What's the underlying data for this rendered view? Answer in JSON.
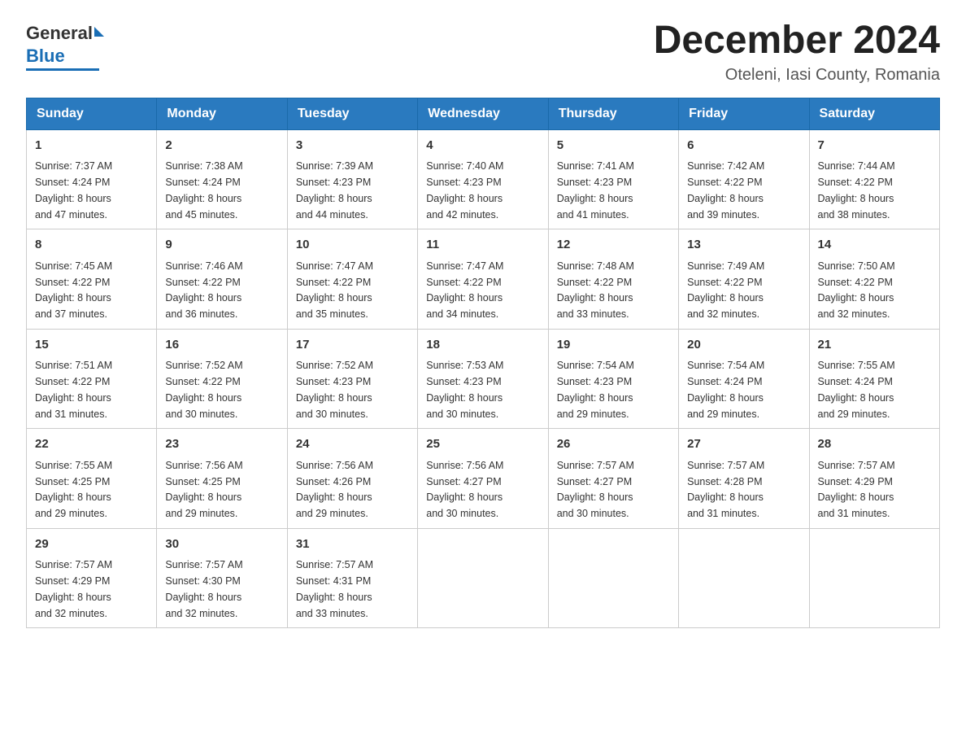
{
  "header": {
    "logo_general": "General",
    "logo_blue": "Blue",
    "month_title": "December 2024",
    "location": "Oteleni, Iasi County, Romania"
  },
  "days_of_week": [
    "Sunday",
    "Monday",
    "Tuesday",
    "Wednesday",
    "Thursday",
    "Friday",
    "Saturday"
  ],
  "weeks": [
    [
      {
        "num": "1",
        "sunrise": "7:37 AM",
        "sunset": "4:24 PM",
        "daylight": "8 hours and 47 minutes."
      },
      {
        "num": "2",
        "sunrise": "7:38 AM",
        "sunset": "4:24 PM",
        "daylight": "8 hours and 45 minutes."
      },
      {
        "num": "3",
        "sunrise": "7:39 AM",
        "sunset": "4:23 PM",
        "daylight": "8 hours and 44 minutes."
      },
      {
        "num": "4",
        "sunrise": "7:40 AM",
        "sunset": "4:23 PM",
        "daylight": "8 hours and 42 minutes."
      },
      {
        "num": "5",
        "sunrise": "7:41 AM",
        "sunset": "4:23 PM",
        "daylight": "8 hours and 41 minutes."
      },
      {
        "num": "6",
        "sunrise": "7:42 AM",
        "sunset": "4:22 PM",
        "daylight": "8 hours and 39 minutes."
      },
      {
        "num": "7",
        "sunrise": "7:44 AM",
        "sunset": "4:22 PM",
        "daylight": "8 hours and 38 minutes."
      }
    ],
    [
      {
        "num": "8",
        "sunrise": "7:45 AM",
        "sunset": "4:22 PM",
        "daylight": "8 hours and 37 minutes."
      },
      {
        "num": "9",
        "sunrise": "7:46 AM",
        "sunset": "4:22 PM",
        "daylight": "8 hours and 36 minutes."
      },
      {
        "num": "10",
        "sunrise": "7:47 AM",
        "sunset": "4:22 PM",
        "daylight": "8 hours and 35 minutes."
      },
      {
        "num": "11",
        "sunrise": "7:47 AM",
        "sunset": "4:22 PM",
        "daylight": "8 hours and 34 minutes."
      },
      {
        "num": "12",
        "sunrise": "7:48 AM",
        "sunset": "4:22 PM",
        "daylight": "8 hours and 33 minutes."
      },
      {
        "num": "13",
        "sunrise": "7:49 AM",
        "sunset": "4:22 PM",
        "daylight": "8 hours and 32 minutes."
      },
      {
        "num": "14",
        "sunrise": "7:50 AM",
        "sunset": "4:22 PM",
        "daylight": "8 hours and 32 minutes."
      }
    ],
    [
      {
        "num": "15",
        "sunrise": "7:51 AM",
        "sunset": "4:22 PM",
        "daylight": "8 hours and 31 minutes."
      },
      {
        "num": "16",
        "sunrise": "7:52 AM",
        "sunset": "4:22 PM",
        "daylight": "8 hours and 30 minutes."
      },
      {
        "num": "17",
        "sunrise": "7:52 AM",
        "sunset": "4:23 PM",
        "daylight": "8 hours and 30 minutes."
      },
      {
        "num": "18",
        "sunrise": "7:53 AM",
        "sunset": "4:23 PM",
        "daylight": "8 hours and 30 minutes."
      },
      {
        "num": "19",
        "sunrise": "7:54 AM",
        "sunset": "4:23 PM",
        "daylight": "8 hours and 29 minutes."
      },
      {
        "num": "20",
        "sunrise": "7:54 AM",
        "sunset": "4:24 PM",
        "daylight": "8 hours and 29 minutes."
      },
      {
        "num": "21",
        "sunrise": "7:55 AM",
        "sunset": "4:24 PM",
        "daylight": "8 hours and 29 minutes."
      }
    ],
    [
      {
        "num": "22",
        "sunrise": "7:55 AM",
        "sunset": "4:25 PM",
        "daylight": "8 hours and 29 minutes."
      },
      {
        "num": "23",
        "sunrise": "7:56 AM",
        "sunset": "4:25 PM",
        "daylight": "8 hours and 29 minutes."
      },
      {
        "num": "24",
        "sunrise": "7:56 AM",
        "sunset": "4:26 PM",
        "daylight": "8 hours and 29 minutes."
      },
      {
        "num": "25",
        "sunrise": "7:56 AM",
        "sunset": "4:27 PM",
        "daylight": "8 hours and 30 minutes."
      },
      {
        "num": "26",
        "sunrise": "7:57 AM",
        "sunset": "4:27 PM",
        "daylight": "8 hours and 30 minutes."
      },
      {
        "num": "27",
        "sunrise": "7:57 AM",
        "sunset": "4:28 PM",
        "daylight": "8 hours and 31 minutes."
      },
      {
        "num": "28",
        "sunrise": "7:57 AM",
        "sunset": "4:29 PM",
        "daylight": "8 hours and 31 minutes."
      }
    ],
    [
      {
        "num": "29",
        "sunrise": "7:57 AM",
        "sunset": "4:29 PM",
        "daylight": "8 hours and 32 minutes."
      },
      {
        "num": "30",
        "sunrise": "7:57 AM",
        "sunset": "4:30 PM",
        "daylight": "8 hours and 32 minutes."
      },
      {
        "num": "31",
        "sunrise": "7:57 AM",
        "sunset": "4:31 PM",
        "daylight": "8 hours and 33 minutes."
      },
      null,
      null,
      null,
      null
    ]
  ],
  "labels": {
    "sunrise": "Sunrise:",
    "sunset": "Sunset:",
    "daylight": "Daylight:"
  }
}
